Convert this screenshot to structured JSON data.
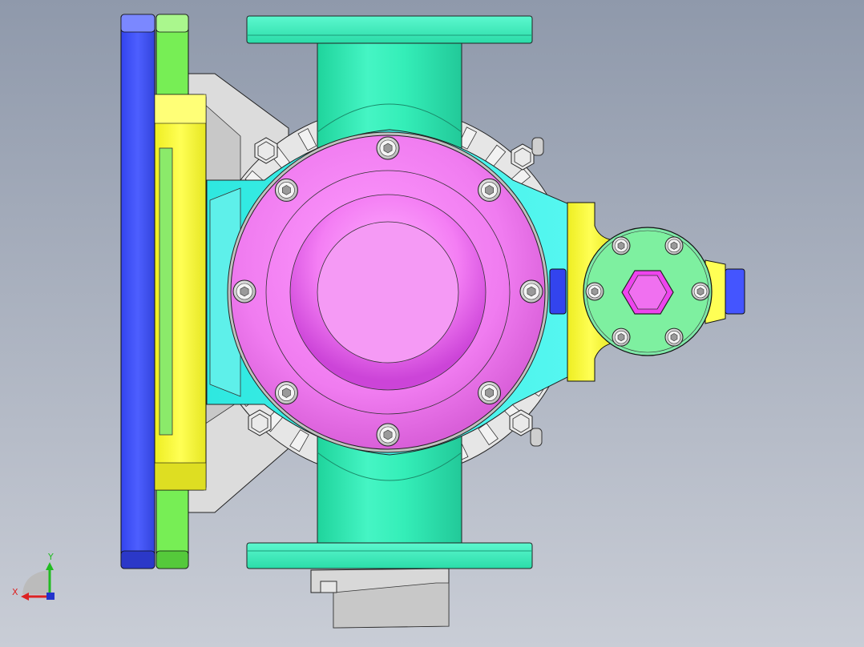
{
  "viewport": {
    "background_top": "#8f99ab",
    "background_bottom": "#c9cdd6"
  },
  "colors": {
    "cover": "#f07cf0",
    "cover_dark": "#c94fd0",
    "pipe": "#33eeb8",
    "pipe_light": "#7ef7d6",
    "body_cyan": "#35f0e8",
    "yellow": "#ffff44",
    "green": "#77ee55",
    "blue": "#4455ff",
    "gray": "#d8d8d8",
    "gray_dark": "#b8b8b8",
    "bolt": "#e8e8e8",
    "edge": "#1a1a1a"
  },
  "triad": {
    "x_label": "X",
    "y_label": "Y",
    "x_color": "#dd2222",
    "y_color": "#22bb22",
    "z_color": "#2233cc"
  },
  "icons": [
    "hex-bolt-icon",
    "socket-head-bolt-icon"
  ]
}
